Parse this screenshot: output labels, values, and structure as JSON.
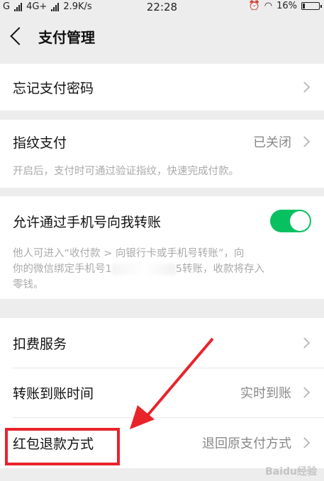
{
  "status_bar": {
    "carrier": "G",
    "network": "4G+",
    "speed": "2.9K/s",
    "time": "22:28",
    "battery": "16%",
    "battery_level": 0.16
  },
  "header": {
    "title": "支付管理"
  },
  "sections": {
    "forgot_password": {
      "label": "忘记支付密码"
    },
    "fingerprint": {
      "label": "指纹支付",
      "value": "已关闭",
      "description": "开启后，支付时可通过验证指纹，快速完成付款。"
    },
    "phone_transfer": {
      "label": "允许通过手机号向我转账",
      "toggle_on": true,
      "description_line1": "他人可进入“收付款 > 向银行卡或手机号转账”，向",
      "description_line2_prefix": "你的微信绑定手机号1",
      "description_line2_suffix": "5转账，收款将存入",
      "description_line3": "零钱。"
    },
    "deduction": {
      "label": "扣费服务"
    },
    "transfer_time": {
      "label": "转账到账时间",
      "value": "实时到账"
    },
    "red_packet_refund": {
      "label": "红包退款方式",
      "value": "退回原支付方式"
    }
  },
  "colors": {
    "toggle_on": "#07c160",
    "annotation": "#e8232a"
  },
  "watermark": "Baidu经验"
}
